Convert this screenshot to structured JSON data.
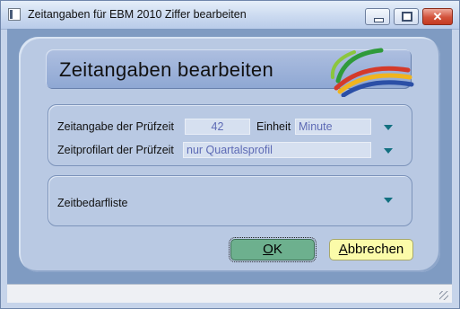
{
  "window": {
    "title": "Zeitangaben für EBM 2010 Ziffer bearbeiten",
    "icon": "app-window-icon",
    "controls": [
      "minimize-icon",
      "maximize-icon",
      "close-icon"
    ]
  },
  "header": {
    "title": "Zeitangaben bearbeiten",
    "logo": "swoosh-logo"
  },
  "pruefzeit": {
    "label": "Zeitangabe der Prüfzeit",
    "value": "42",
    "unit_label": "Einheit",
    "unit_value": "Minute"
  },
  "profil": {
    "label": "Zeitprofilart der Prüfzeit",
    "value": "nur Quartalsprofil"
  },
  "zeitbedarf": {
    "label": "Zeitbedarfliste"
  },
  "buttons": {
    "ok_label": "OK",
    "ok_mnemonic": "O",
    "ok_rest": "K",
    "cancel_label": "Abbrechen",
    "cancel_mnemonic": "A",
    "cancel_rest": "bbrechen"
  },
  "colors": {
    "panel": "#b9c9e3",
    "ok_button": "#6db08e",
    "cancel_button": "#fbfba9",
    "dropdown_arrow": "#127080",
    "field_text": "#5d6ab5"
  }
}
